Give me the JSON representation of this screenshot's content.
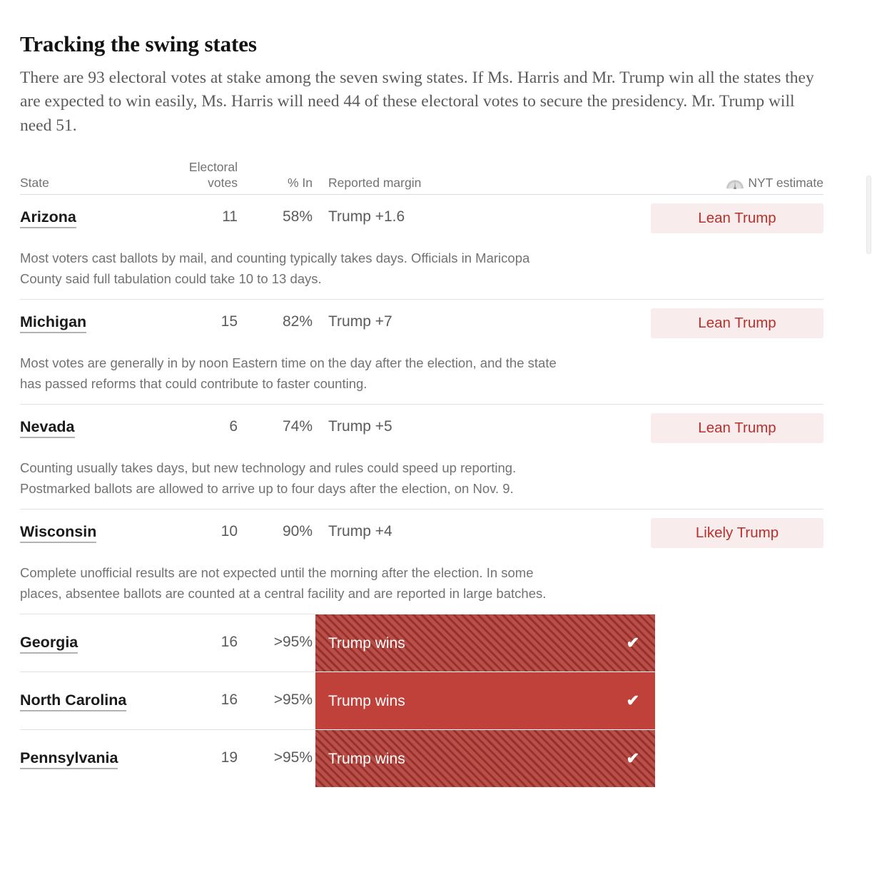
{
  "article": {
    "headline": "Tracking the swing states",
    "standfirst": "There are 93 electoral votes at stake among the seven swing states. If Ms. Harris and Mr. Trump win all the states they are expected to win easily, Ms. Harris will need 44 of these electoral votes to secure the presidency. Mr. Trump will need 51."
  },
  "table": {
    "headers": {
      "state": "State",
      "electoral_votes_line1": "Electoral",
      "electoral_votes_line2": "votes",
      "percent_in": "% In",
      "reported_margin": "Reported margin",
      "nyt_estimate": "NYT estimate",
      "nyt_estimate_icon": "gauge-icon"
    },
    "rows": [
      {
        "state": "Arizona",
        "electoral_votes": "11",
        "percent_in": "58%",
        "reported_margin": "Trump +1.6",
        "estimate": "Lean Trump",
        "estimate_type": "badge",
        "note": "Most voters cast ballots by mail, and counting typically takes days. Officials in Maricopa County said full tabulation could take 10 to 13 days."
      },
      {
        "state": "Michigan",
        "electoral_votes": "15",
        "percent_in": "82%",
        "reported_margin": "Trump +7",
        "estimate": "Lean Trump",
        "estimate_type": "badge",
        "note": "Most votes are generally in by noon Eastern time on the day after the election, and the state has passed reforms that could contribute to faster counting."
      },
      {
        "state": "Nevada",
        "electoral_votes": "6",
        "percent_in": "74%",
        "reported_margin": "Trump +5",
        "estimate": "Lean Trump",
        "estimate_type": "badge",
        "note": "Counting usually takes days, but new technology and rules could speed up reporting. Postmarked ballots are allowed to arrive up to four days after the election, on Nov. 9."
      },
      {
        "state": "Wisconsin",
        "electoral_votes": "10",
        "percent_in": "90%",
        "reported_margin": "Trump +4",
        "estimate": "Likely Trump",
        "estimate_type": "badge",
        "note": "Complete unofficial results are not expected until the morning after the election. In some places, absentee ballots are counted at a central facility and are reported in large batches."
      },
      {
        "state": "Georgia",
        "electoral_votes": "16",
        "percent_in": ">95%",
        "reported_margin": "Trump wins",
        "estimate": "",
        "estimate_type": "winner-striped",
        "check": "✔",
        "note": ""
      },
      {
        "state": "North Carolina",
        "electoral_votes": "16",
        "percent_in": ">95%",
        "reported_margin": "Trump wins",
        "estimate": "",
        "estimate_type": "winner-solid",
        "check": "✔",
        "note": ""
      },
      {
        "state": "Pennsylvania",
        "electoral_votes": "19",
        "percent_in": ">95%",
        "reported_margin": "Trump wins",
        "estimate": "",
        "estimate_type": "winner-striped",
        "check": "✔",
        "note": ""
      }
    ]
  },
  "colors": {
    "trump_red": "#c0403a",
    "trump_red_striped": "#b23a34",
    "badge_bg": "#f9ecec",
    "badge_text": "#b8302c",
    "body_text": "#5a5a5a",
    "heading_text": "#121212",
    "rule": "#e2e2e2"
  }
}
